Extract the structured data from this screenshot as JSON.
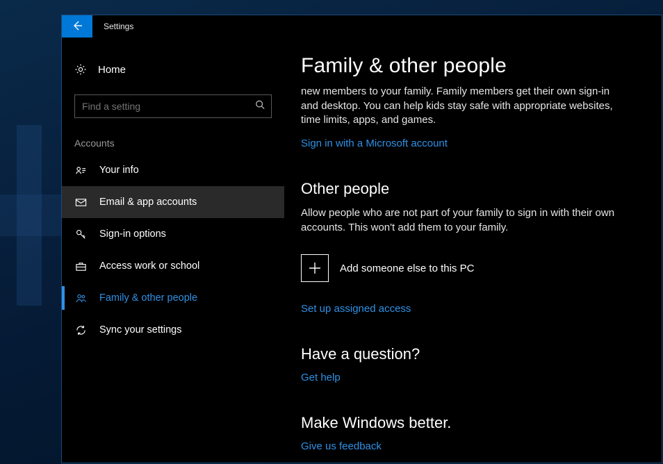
{
  "window": {
    "title": "Settings"
  },
  "sidebar": {
    "home": "Home",
    "search_placeholder": "Find a setting",
    "section": "Accounts",
    "items": [
      {
        "label": "Your info"
      },
      {
        "label": "Email & app accounts"
      },
      {
        "label": "Sign-in options"
      },
      {
        "label": "Access work or school"
      },
      {
        "label": "Family & other people"
      },
      {
        "label": "Sync your settings"
      }
    ]
  },
  "content": {
    "title": "Family & other people",
    "family_descr": "new members to your family. Family members get their own sign-in and desktop. You can help kids stay safe with appropriate websites, time limits, apps, and games.",
    "signin_link": "Sign in with a Microsoft account",
    "other_heading": "Other people",
    "other_descr": "Allow people who are not part of your family to sign in with their own accounts. This won't add them to your family.",
    "add_label": "Add someone else to this PC",
    "assigned_link": "Set up assigned access",
    "question_heading": "Have a question?",
    "help_link": "Get help",
    "improve_heading": "Make Windows better.",
    "feedback_link": "Give us feedback"
  }
}
